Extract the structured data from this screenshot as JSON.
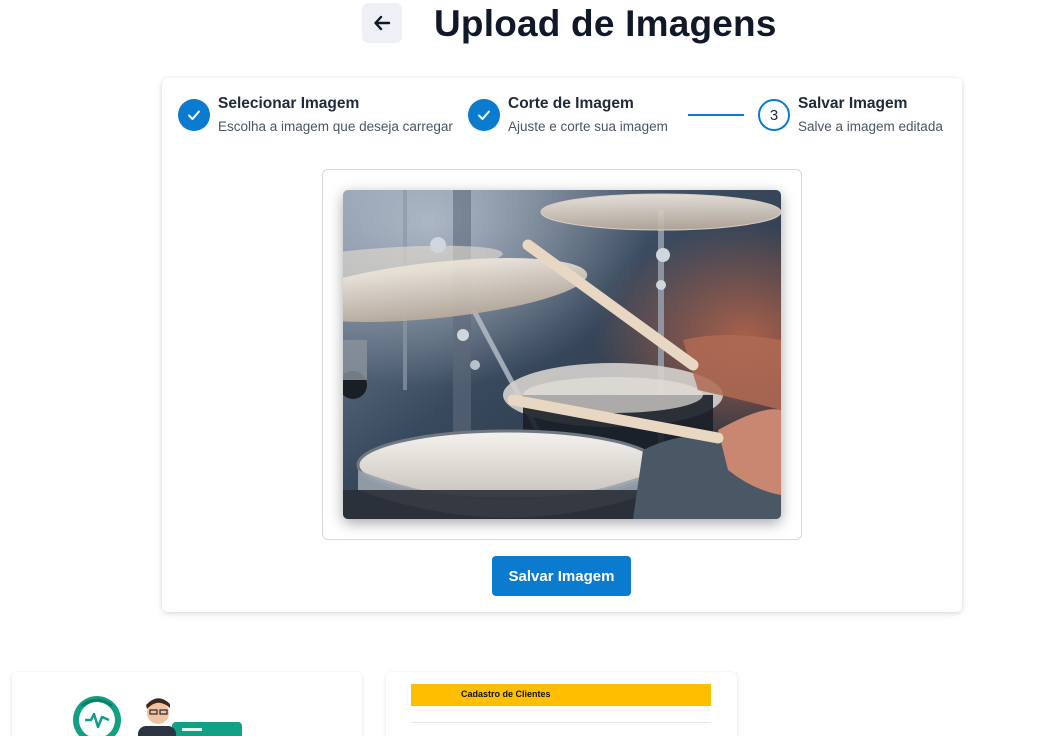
{
  "header": {
    "title": "Upload de Imagens",
    "back_icon": "arrow-left-icon"
  },
  "steps": [
    {
      "title": "Selecionar Imagem",
      "subtitle": "Escolha a imagem que deseja carregar",
      "status": "done",
      "icon": "check-icon"
    },
    {
      "title": "Corte de Imagem",
      "subtitle": "Ajuste e corte sua imagem",
      "status": "done",
      "icon": "check-icon"
    },
    {
      "title": "Salvar Imagem",
      "subtitle": "Salve a imagem editada",
      "status": "active",
      "number": "3"
    }
  ],
  "preview": {
    "subject": "drum kit being played with drumsticks"
  },
  "actions": {
    "save_label": "Salvar Imagem"
  },
  "gallery": {
    "card2_banner": "Cadastro de Clientes"
  },
  "colors": {
    "accent": "#0b7bd0",
    "banner": "#ffbf00",
    "health_green": "#12a085"
  }
}
